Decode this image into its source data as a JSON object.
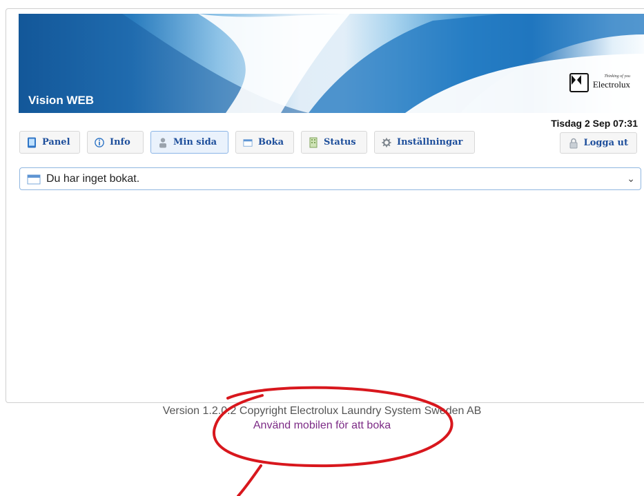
{
  "header": {
    "app_title": "Vision WEB",
    "brand_name": "Electrolux",
    "brand_tagline": "Thinking of you",
    "datetime": "Tisdag 2 Sep 07:31"
  },
  "nav": {
    "items": [
      {
        "label": "Panel",
        "icon": "tablet-icon"
      },
      {
        "label": "Info",
        "icon": "info-icon"
      },
      {
        "label": "Min sida",
        "icon": "user-icon",
        "active": true
      },
      {
        "label": "Boka",
        "icon": "calendar-icon"
      },
      {
        "label": "Status",
        "icon": "building-icon"
      },
      {
        "label": "Inställningar",
        "icon": "gear-icon"
      }
    ],
    "logout_label": "Logga ut"
  },
  "booking_select": {
    "value": "Du har inget bokat."
  },
  "footer": {
    "version_text": "Version 1.2.0.2 Copyright Electrolux Laundry System Sweden AB",
    "mobile_link": "Använd mobilen för att boka"
  },
  "colors": {
    "accent_blue": "#1d4e9b",
    "link_purple": "#7c2b86",
    "annotation_red": "#d8171d"
  }
}
